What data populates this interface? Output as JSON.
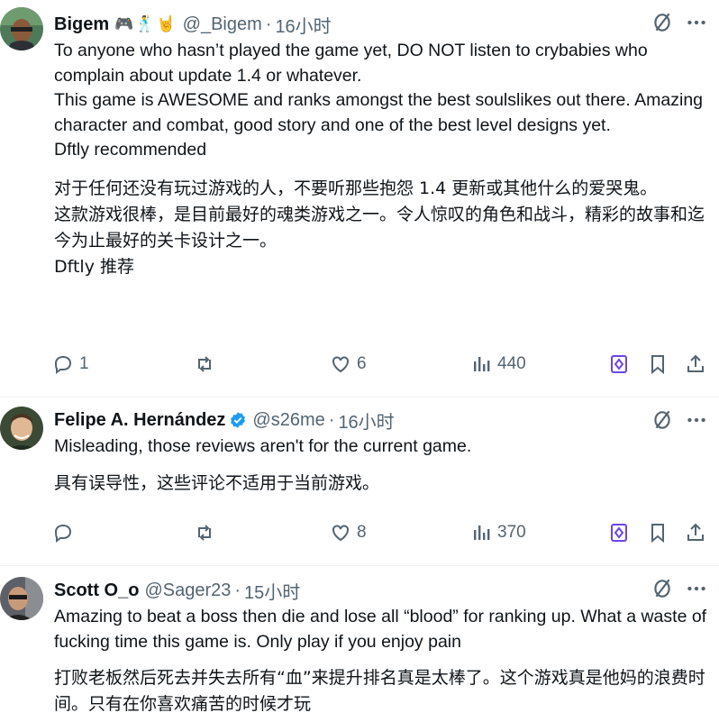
{
  "colors": {
    "text": "#0f1419",
    "secondary": "#536471",
    "verified": "#1d9bf0",
    "grok": "#6c44e6",
    "divider": "#eff3f4"
  },
  "tweets": [
    {
      "name": "Bigem",
      "name_emoji": "🎮🕺🤘",
      "handle": "@_Bigem",
      "separator": "·",
      "time": "16小时",
      "verified": false,
      "text_en": "To anyone who hasn’t played the game yet, DO NOT listen to crybabies who complain about update 1.4 or whatever.\nThis game is AWESOME and ranks amongst the best soulslikes out there. Amazing character and combat, good story and one of the best level designs yet.\nDftly recommended",
      "text_zh": "对于任何还没有玩过游戏的人，不要听那些抱怨 1.4 更新或其他什么的爱哭鬼。\n这款游戏很棒，是目前最好的魂类游戏之一。令人惊叹的角色和战斗，精彩的故事和迄今为止最好的关卡设计之一。\nDftly 推荐",
      "replies": "1",
      "retweets": "",
      "likes": "6",
      "views": "440"
    },
    {
      "name": "Felipe A. Hernández",
      "name_emoji": "",
      "handle": "@s26me",
      "separator": "·",
      "time": "16小时",
      "verified": true,
      "text_en": "Misleading, those reviews aren't for the current game.",
      "text_zh": "具有误导性，这些评论不适用于当前游戏。",
      "replies": "",
      "retweets": "",
      "likes": "8",
      "views": "370"
    },
    {
      "name": "Scott O_o",
      "name_emoji": "",
      "handle": "@Sager23",
      "separator": "·",
      "time": "15小时",
      "verified": false,
      "text_en": "Amazing to beat a boss then die and lose all “blood” for ranking up. What a waste of fucking time this game is. Only play if you enjoy pain",
      "text_zh": "打败老板然后死去并失去所有“血”来提升排名真是太棒了。这个游戏真是他妈的浪费时间。只有在你喜欢痛苦的时候才玩",
      "replies": "",
      "retweets": "",
      "likes": "",
      "views": ""
    }
  ]
}
